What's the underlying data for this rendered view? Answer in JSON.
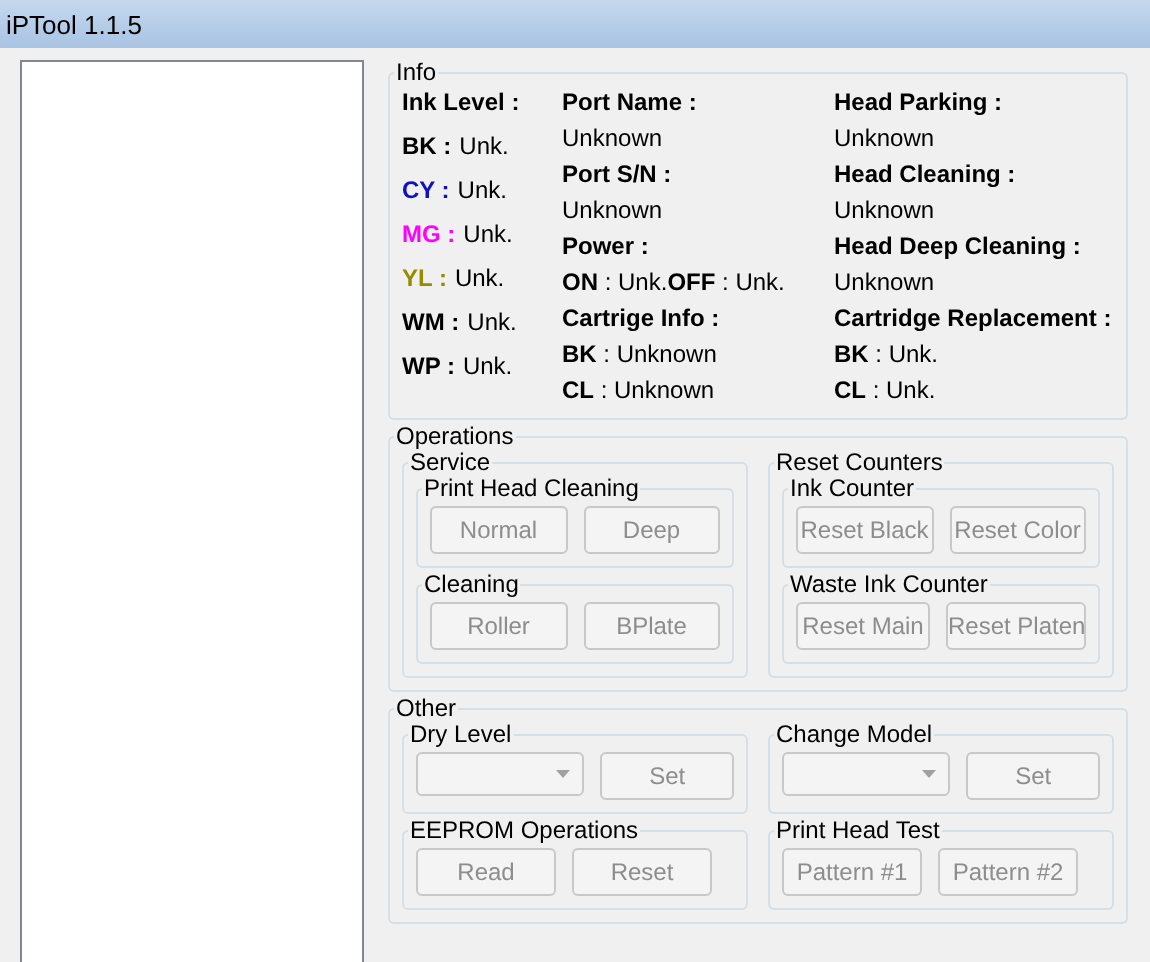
{
  "window": {
    "title": "iPTool 1.1.5"
  },
  "info": {
    "title": "Info",
    "ink_level": {
      "label": "Ink Level :",
      "items": [
        {
          "name": "BK :",
          "value": "Unk.",
          "color": "#000000"
        },
        {
          "name": "CY :",
          "value": "Unk.",
          "color": "#1010c0"
        },
        {
          "name": "MG :",
          "value": "Unk.",
          "color": "#ff00ff"
        },
        {
          "name": "YL :",
          "value": "Unk.",
          "color": "#968c00"
        },
        {
          "name": "WM :",
          "value": "Unk.",
          "color": "#000000"
        },
        {
          "name": "WP :",
          "value": "Unk.",
          "color": "#000000"
        }
      ]
    },
    "columns": [
      [
        {
          "kind": "label",
          "text": "Port Name :"
        },
        {
          "kind": "value",
          "text": "Unknown"
        },
        {
          "kind": "label",
          "text": "Port S/N :"
        },
        {
          "kind": "value",
          "text": "Unknown"
        },
        {
          "kind": "label",
          "text": "Power :"
        },
        {
          "kind": "value",
          "text": "**ON** : Unk.**OFF** : Unk."
        },
        {
          "kind": "label",
          "text": "Cartrige Info :"
        },
        {
          "kind": "value",
          "text": "**BK** : Unknown"
        },
        {
          "kind": "value",
          "text": "**CL** : Unknown"
        }
      ],
      [
        {
          "kind": "label",
          "text": "Head Parking :"
        },
        {
          "kind": "value",
          "text": "Unknown"
        },
        {
          "kind": "label",
          "text": "Head Cleaning :"
        },
        {
          "kind": "value",
          "text": "Unknown"
        },
        {
          "kind": "label",
          "text": "Head Deep Cleaning :"
        },
        {
          "kind": "value",
          "text": "Unknown"
        },
        {
          "kind": "label",
          "text": "Cartridge Replacement :"
        },
        {
          "kind": "value",
          "text": "**BK** : Unk."
        },
        {
          "kind": "value",
          "text": "**CL** : Unk."
        }
      ]
    ]
  },
  "sections": [
    {
      "title": "Operations",
      "groups": [
        {
          "title": "Service",
          "boxes": [
            {
              "title": "Print Head Cleaning",
              "controls": [
                {
                  "kind": "button",
                  "label": "Normal",
                  "disabled": true
                },
                {
                  "kind": "button",
                  "label": "Deep",
                  "disabled": true
                }
              ]
            },
            {
              "title": "Cleaning",
              "controls": [
                {
                  "kind": "button",
                  "label": "Roller",
                  "disabled": true
                },
                {
                  "kind": "button",
                  "label": "BPlate",
                  "disabled": true
                }
              ]
            }
          ]
        },
        {
          "title": "Reset Counters",
          "boxes": [
            {
              "title": "Ink Counter",
              "controls": [
                {
                  "kind": "button",
                  "label": "Reset Black",
                  "disabled": true
                },
                {
                  "kind": "button",
                  "label": "Reset Color",
                  "disabled": true
                }
              ]
            },
            {
              "title": "Waste Ink Counter",
              "controls": [
                {
                  "kind": "button",
                  "label": "Reset Main",
                  "disabled": true
                },
                {
                  "kind": "button",
                  "label": "Reset Platen",
                  "disabled": true
                }
              ]
            }
          ]
        }
      ]
    },
    {
      "title": "Other",
      "groups": [
        {
          "boxes": [
            {
              "title": "Dry Level",
              "controls": [
                {
                  "kind": "dropdown",
                  "disabled": true
                },
                {
                  "kind": "button",
                  "label": "Set",
                  "disabled": true
                }
              ]
            },
            {
              "title": "EEPROM Operations",
              "controls": [
                {
                  "kind": "button",
                  "label": "Read",
                  "disabled": true
                },
                {
                  "kind": "button",
                  "label": "Reset",
                  "disabled": true
                }
              ]
            }
          ]
        },
        {
          "boxes": [
            {
              "title": "Change Model",
              "controls": [
                {
                  "kind": "dropdown",
                  "disabled": true
                },
                {
                  "kind": "button",
                  "label": "Set",
                  "disabled": true
                }
              ]
            },
            {
              "title": "Print Head Test",
              "controls": [
                {
                  "kind": "button",
                  "label": "Pattern #1",
                  "disabled": true
                },
                {
                  "kind": "button",
                  "label": "Pattern #2",
                  "disabled": true
                }
              ]
            }
          ]
        }
      ]
    }
  ]
}
